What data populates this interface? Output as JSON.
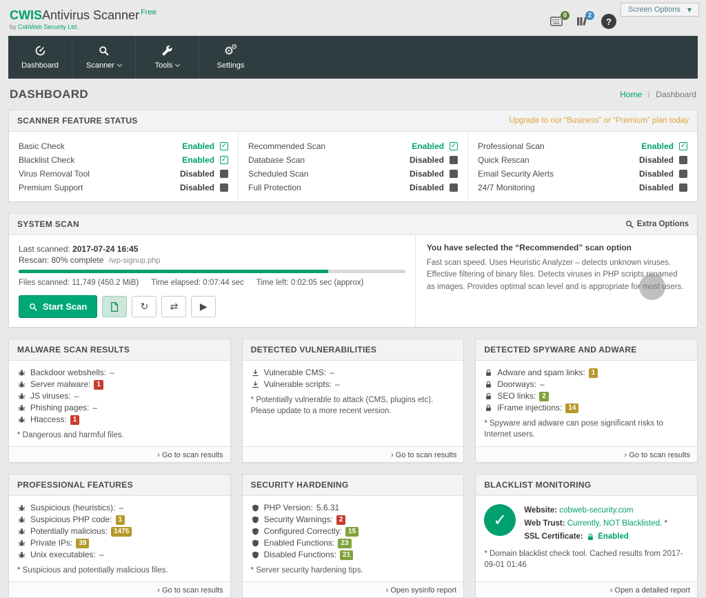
{
  "colors": {
    "accent_green": "#00a06e",
    "nav_bg": "#303d40",
    "upgrade_orange": "#dfa43d",
    "badge_red": "#ca3c2e",
    "badge_yellow": "#b5992b",
    "badge_green": "#7fa33c",
    "badge_blue": "#3f8abf",
    "badge_olive": "#5f7d3a"
  },
  "header": {
    "brand": "CWIS",
    "product": "Antivirus Scanner",
    "plan": "Free",
    "byline_prefix": "by",
    "company": "CobWeb Security Ltd.",
    "console_badge": "0",
    "library_badge": "2",
    "help": "?",
    "screen_options": "Screen Options"
  },
  "nav": {
    "items": [
      {
        "label": "Dashboard",
        "icon": "dashboard-icon",
        "caret": false
      },
      {
        "label": "Scanner",
        "icon": "search-icon",
        "caret": true
      },
      {
        "label": "Tools",
        "icon": "wrench-icon",
        "caret": true
      },
      {
        "label": "Settings",
        "icon": "gears-icon",
        "caret": false
      }
    ]
  },
  "page": {
    "title": "DASHBOARD",
    "breadcrumb_home": "Home",
    "breadcrumb_sep": "/",
    "breadcrumb_current": "Dashboard"
  },
  "feature_status": {
    "title": "SCANNER FEATURE STATUS",
    "upgrade_link": "Upgrade to our “Business” or “Premium” plan today",
    "columns": [
      [
        {
          "label": "Basic Check",
          "status": "Enabled"
        },
        {
          "label": "Blacklist Check",
          "status": "Enabled"
        },
        {
          "label": "Virus Removal Tool",
          "status": "Disabled"
        },
        {
          "label": "Premium Support",
          "status": "Disabled"
        }
      ],
      [
        {
          "label": "Recommended Scan",
          "status": "Enabled"
        },
        {
          "label": "Database Scan",
          "status": "Disabled"
        },
        {
          "label": "Scheduled Scan",
          "status": "Disabled"
        },
        {
          "label": "Full Protection",
          "status": "Disabled"
        }
      ],
      [
        {
          "label": "Professional Scan",
          "status": "Enabled"
        },
        {
          "label": "Quick Rescan",
          "status": "Disabled"
        },
        {
          "label": "Email Security Alerts",
          "status": "Disabled"
        },
        {
          "label": "24/7 Monitoring",
          "status": "Disabled"
        }
      ]
    ]
  },
  "system_scan": {
    "title": "SYSTEM SCAN",
    "extra_options": "Extra Options",
    "last_scanned_label": "Last scanned:",
    "last_scanned_value": "2017-07-24 16:45",
    "rescan_text": "Rescan: 80% complete",
    "rescan_file": "/wp-signup.php",
    "progress_pct": 80,
    "files_scanned": "Files scanned: 11,749 (450.2 MiB)",
    "time_elapsed": "Time elapsed: 0:07:44 sec",
    "time_left": "Time left: 0:02:05 sec (approx)",
    "start_button": "Start Scan",
    "selected_title": "You have selected the “Recommended” scan option",
    "selected_desc": "Fast scan speed. Uses Heuristic Analyzer – detects unknown viruses. Effective filtering of binary files. Detects viruses in PHP scripts renamed as images. Provides optimal scan level and is appropriate for most users."
  },
  "cards": [
    {
      "id": "malware-scan-results",
      "type": "list",
      "title": "MALWARE SCAN RESULTS",
      "icon": "bug-icon",
      "items": [
        {
          "label": "Backdoor webshells:",
          "value": "–"
        },
        {
          "label": "Server malware:",
          "badge": "1",
          "badge_color": "red"
        },
        {
          "label": "JS viruses:",
          "value": "–"
        },
        {
          "label": "Phishing pages:",
          "value": "–"
        },
        {
          "label": "Htaccess:",
          "badge": "1",
          "badge_color": "red"
        }
      ],
      "note": "* Dangerous and harmful files.",
      "footer": "Go to scan results"
    },
    {
      "id": "detected-vulnerabilities",
      "type": "list",
      "title": "DETECTED VULNERABILITIES",
      "icon": "download-icon",
      "items": [
        {
          "label": "Vulnerable CMS:",
          "value": "–"
        },
        {
          "label": "Vulnerable scripts:",
          "value": "–"
        }
      ],
      "note": "* Potentially vulnerable to attack (CMS, plugins etc). Please update to a more recent version.",
      "footer": "Go to scan results"
    },
    {
      "id": "detected-spyware-and-adware",
      "type": "list",
      "title": "DETECTED SPYWARE AND ADWARE",
      "icon": "lock-icon",
      "items": [
        {
          "label": "Adware and spam links:",
          "badge": "1",
          "badge_color": "yellow"
        },
        {
          "label": "Doorways:",
          "value": "–"
        },
        {
          "label": "SEO links:",
          "badge": "2",
          "badge_color": "green"
        },
        {
          "label": "iFrame injections:",
          "badge": "14",
          "badge_color": "yellow"
        }
      ],
      "note": "* Spyware and adware can pose significant risks to Internet users.",
      "footer": "Go to scan results"
    },
    {
      "id": "professional-features",
      "type": "list",
      "title": "PROFESSIONAL FEATURES",
      "icon": "bug-icon",
      "items": [
        {
          "label": "Suspicious (heuristics):",
          "value": "–"
        },
        {
          "label": "Suspicious PHP code:",
          "badge": "1",
          "badge_color": "yellow"
        },
        {
          "label": "Potentially malicious:",
          "badge": "1475",
          "badge_color": "yellow"
        },
        {
          "label": "Private IPs:",
          "badge": "39",
          "badge_color": "yellow"
        },
        {
          "label": "Unix executables:",
          "value": "–"
        }
      ],
      "note": "* Suspicious and potentially malicious files.",
      "footer": "Go to scan results"
    },
    {
      "id": "security-hardening",
      "type": "list",
      "title": "SECURITY HARDENING",
      "icon": "shield-icon",
      "items": [
        {
          "label": "PHP Version:",
          "value": "5.6.31"
        },
        {
          "label": "Security Warnings:",
          "badge": "2",
          "badge_color": "red"
        },
        {
          "label": "Configured Correctly:",
          "badge": "15",
          "badge_color": "green"
        },
        {
          "label": "Enabled Functions:",
          "badge": "23",
          "badge_color": "green"
        },
        {
          "label": "Disabled Functions:",
          "badge": "21",
          "badge_color": "green"
        }
      ],
      "note": "* Server security hardening tips.",
      "footer": "Open sysinfo report"
    },
    {
      "id": "blacklist-monitoring",
      "type": "blacklist",
      "title": "BLACKLIST MONITORING",
      "website_label": "Website:",
      "website_value": "cobweb-security.com",
      "webtrust_label": "Web Trust:",
      "webtrust_value": "Currently, NOT Blacklisted.",
      "webtrust_suffix": "*",
      "ssl_label": "SSL Certificate:",
      "ssl_value": "Enabled",
      "note": "* Domain blacklist check tool. Cached results from 2017-09-01 01:46",
      "footer": "Open a detailed report"
    }
  ]
}
